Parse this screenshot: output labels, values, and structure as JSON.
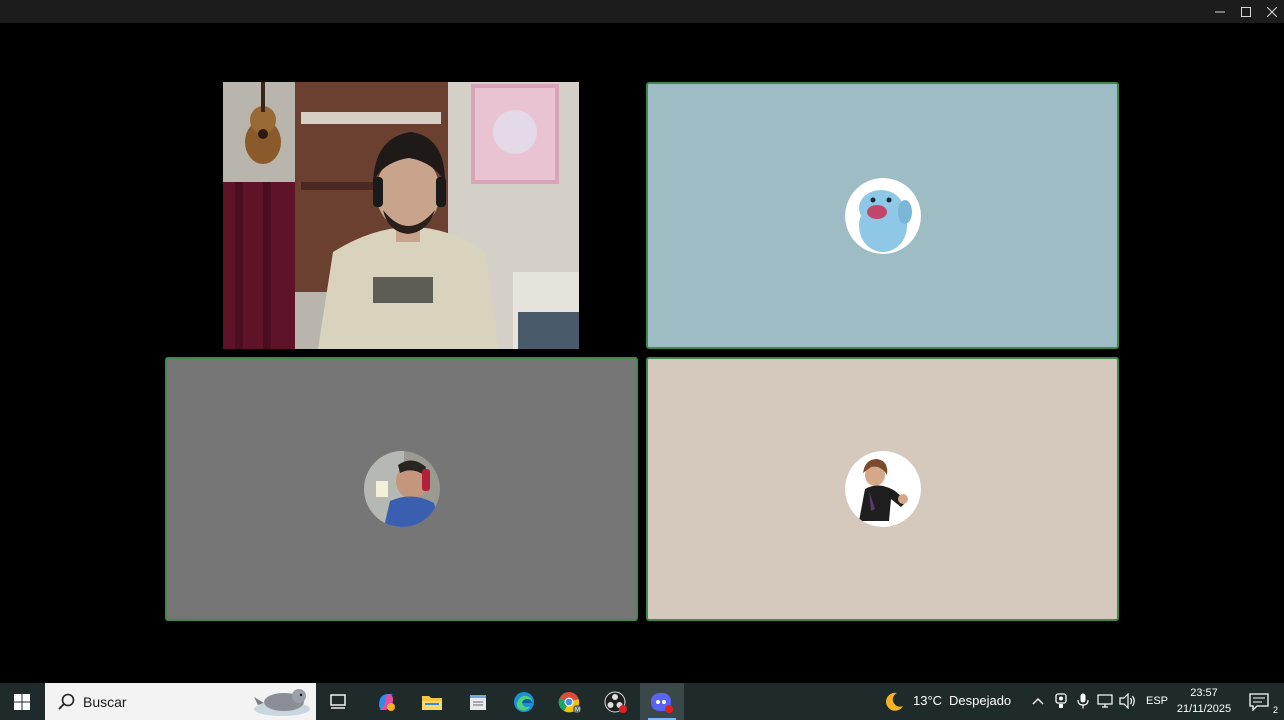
{
  "window": {
    "controls": [
      "minimize",
      "maximize",
      "close"
    ]
  },
  "call": {
    "tiles": [
      {
        "type": "camera",
        "speaking": false
      },
      {
        "type": "avatar",
        "avatar": "quagsire-icon",
        "background": "#9dbcc3",
        "speaking": true
      },
      {
        "type": "avatar",
        "avatar": "user-photo-headset",
        "background": "#767676",
        "speaking": true
      },
      {
        "type": "avatar",
        "avatar": "user-photo-dancing",
        "background": "#d5c9bd",
        "speaking": true
      }
    ],
    "colors": {
      "speaking_border": "#3f8a4b",
      "background": "#000000"
    }
  },
  "taskbar": {
    "search_label": "Buscar",
    "apps": [
      "task-view",
      "copilot",
      "file-explorer",
      "notepad",
      "edge",
      "chrome",
      "obs",
      "discord"
    ],
    "active_app": "discord",
    "weather": {
      "temperature": "13°C",
      "condition": "Despejado"
    },
    "language": "ESP",
    "clock": {
      "time": "23:57",
      "date": "21/11/2025"
    },
    "notifications": "2"
  }
}
